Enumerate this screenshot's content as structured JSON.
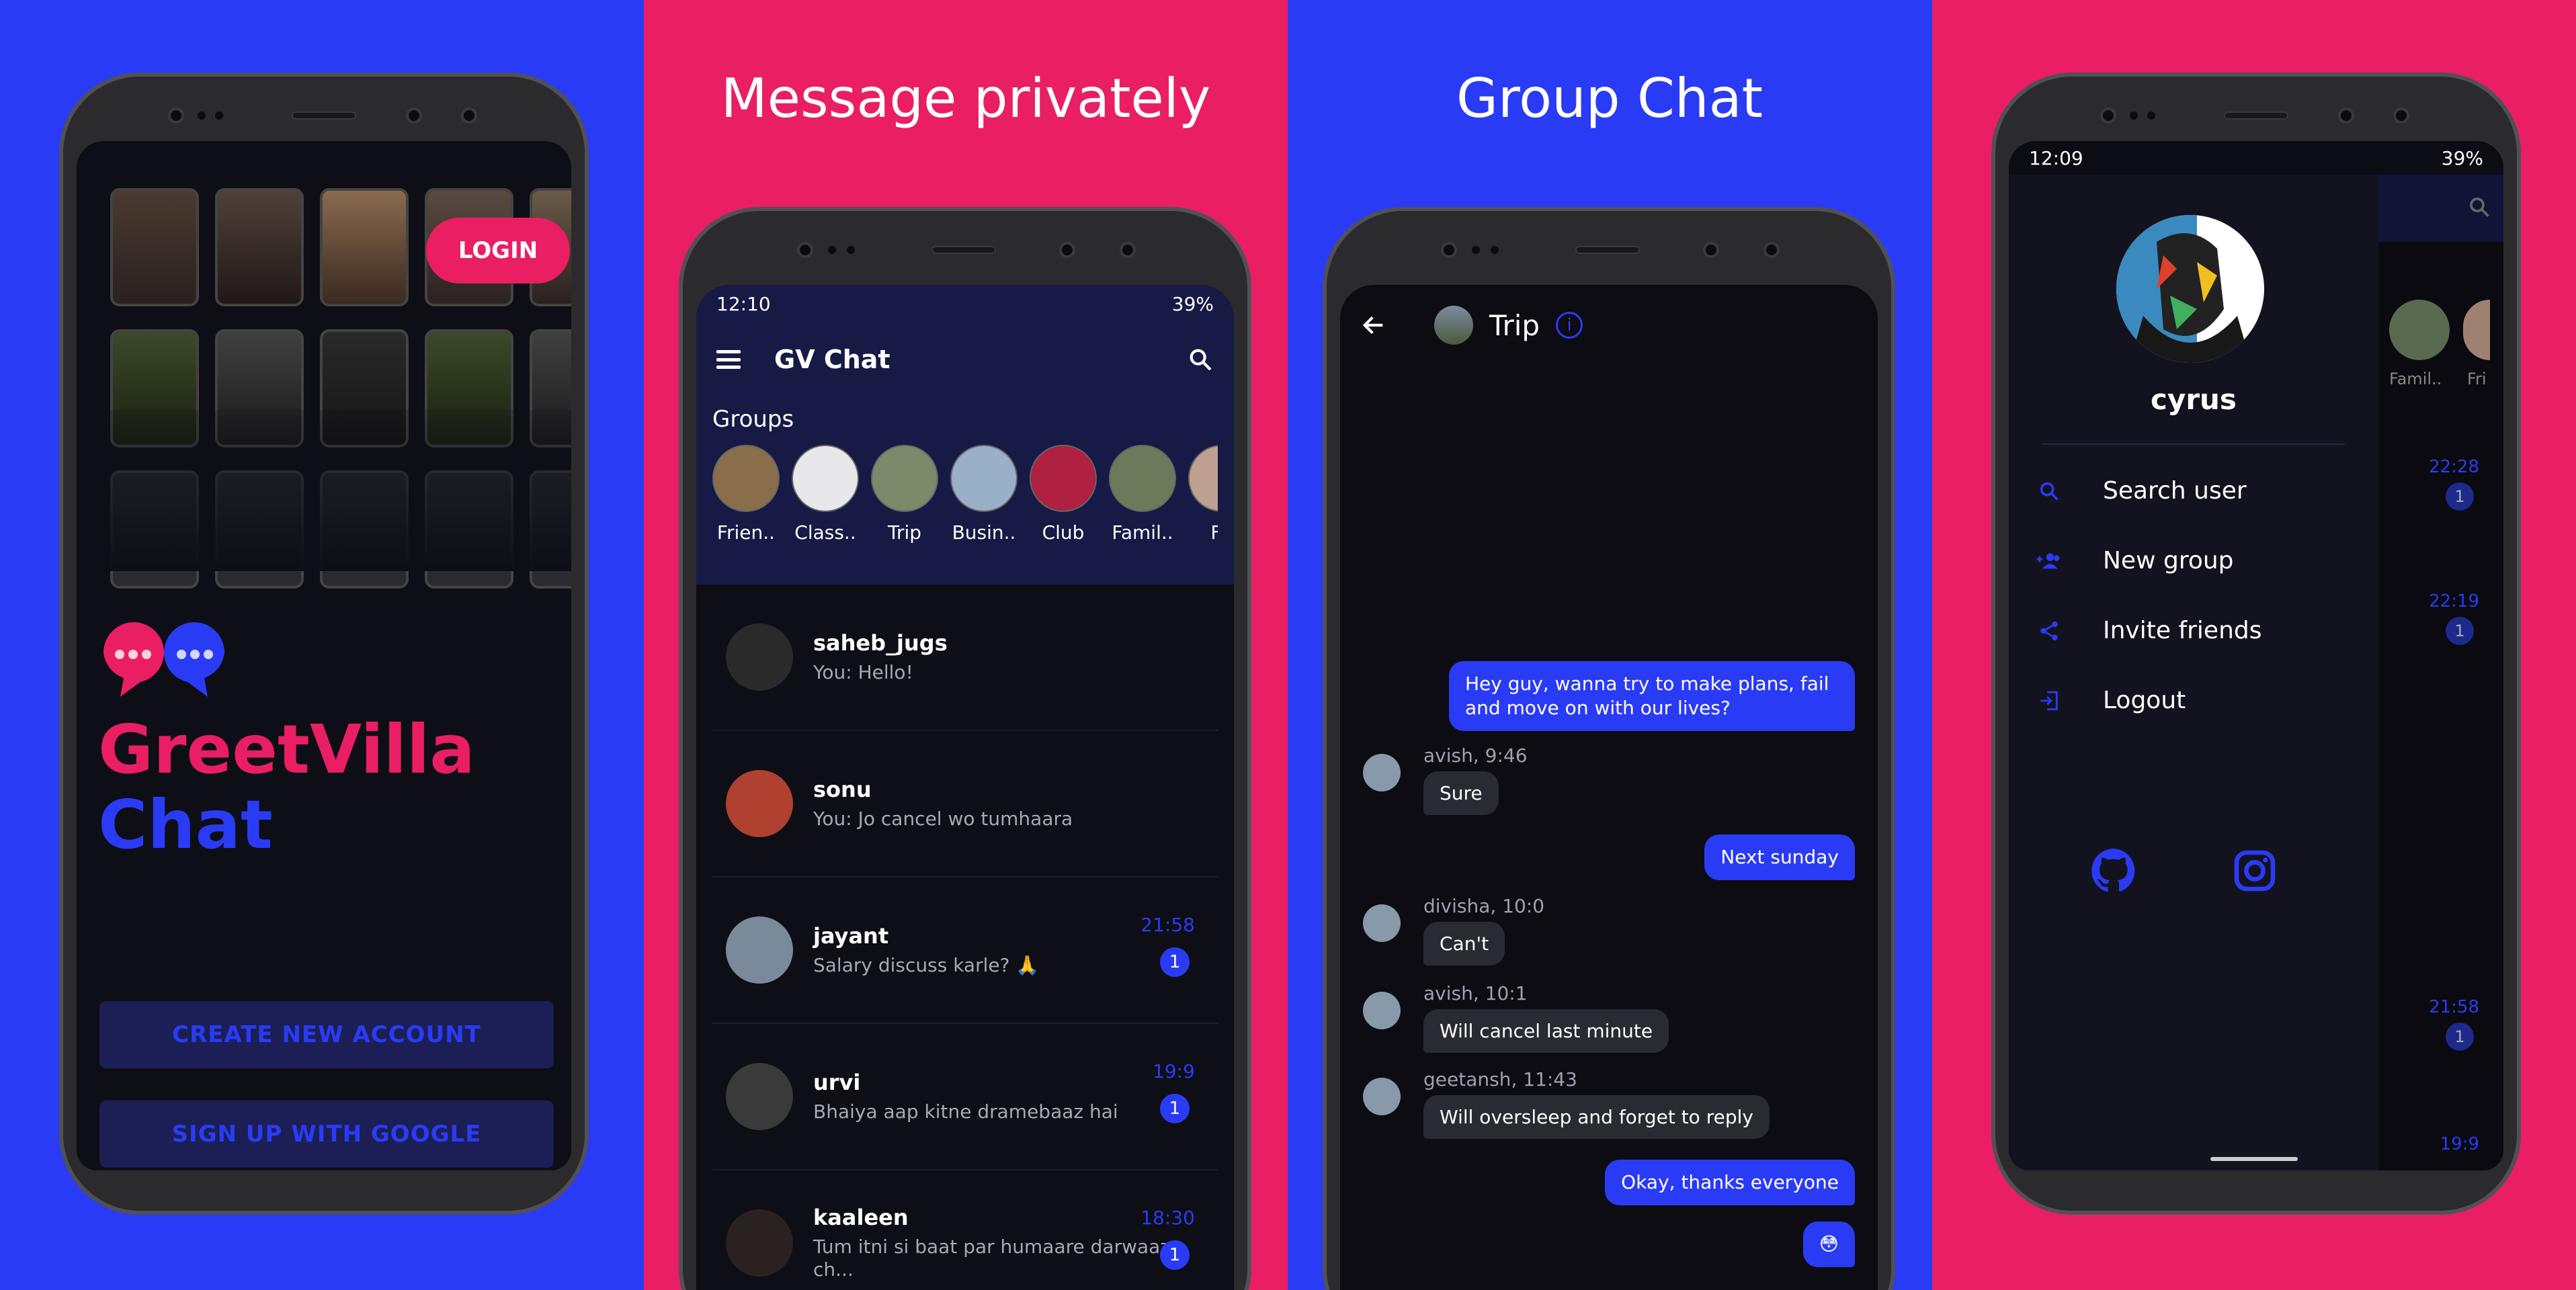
{
  "colors": {
    "blue": "#2a3bf5",
    "pink": "#ea1e63",
    "dark": "#0e0e16",
    "appbar": "#161a45"
  },
  "panel1": {
    "login_label": "LOGIN",
    "brand_line1": "GreetVilla",
    "brand_line2": "Chat",
    "create_account_label": "CREATE NEW ACCOUNT",
    "google_label": "SIGN UP WITH GOOGLE"
  },
  "panel2": {
    "caption": "Message privately",
    "status_time": "12:10",
    "status_battery": "39%",
    "app_title": "GV Chat",
    "groups_heading": "Groups",
    "groups": [
      {
        "name": "Frien..",
        "color": "#8a6d4a"
      },
      {
        "name": "Class..",
        "color": "#e8e8ea"
      },
      {
        "name": "Trip",
        "color": "#7a8a6a"
      },
      {
        "name": "Busin..",
        "color": "#9ab0c8"
      },
      {
        "name": "Club",
        "color": "#b02040"
      },
      {
        "name": "Famil..",
        "color": "#6a7a5a"
      },
      {
        "name": "Fri",
        "color": "#c0a090"
      }
    ],
    "chats": [
      {
        "name": "saheb_jugs",
        "msg": "You: Hello!",
        "time": "",
        "badge": ""
      },
      {
        "name": "sonu",
        "msg": "You: Jo cancel wo tumhaara",
        "time": "",
        "badge": ""
      },
      {
        "name": "jayant",
        "msg": "Salary discuss karle? 🙏",
        "time": "21:58",
        "badge": "1"
      },
      {
        "name": "urvi",
        "msg": "Bhaiya aap kitne dramebaaz hai",
        "time": "19:9",
        "badge": "1"
      },
      {
        "name": "kaaleen",
        "msg": "Tum itni si baat par humaare darwaaze ch...",
        "time": "18:30",
        "badge": "1"
      }
    ]
  },
  "panel3": {
    "caption": "Group Chat",
    "chat_title": "Trip",
    "messages": [
      {
        "dir": "out",
        "text": "Hey guy, wanna try to make plans, fail and move on with our lives?"
      },
      {
        "dir": "in",
        "meta": "avish, 9:46",
        "text": "Sure"
      },
      {
        "dir": "out",
        "text": "Next sunday"
      },
      {
        "dir": "in",
        "meta": "divisha, 10:0",
        "text": "Can't"
      },
      {
        "dir": "in",
        "meta": "avish, 10:1",
        "text": "Will cancel last minute"
      },
      {
        "dir": "in",
        "meta": "geetansh, 11:43",
        "text": "Will oversleep and forget to reply"
      },
      {
        "dir": "out",
        "text": "Okay, thanks everyone"
      },
      {
        "dir": "out",
        "text": "😳"
      }
    ]
  },
  "panel4": {
    "status_time": "12:09",
    "status_battery": "39%",
    "username": "cyrus",
    "menu": [
      {
        "label": "Search user",
        "icon": "search-icon"
      },
      {
        "label": "New group",
        "icon": "group-add-icon"
      },
      {
        "label": "Invite friends",
        "icon": "share-icon"
      },
      {
        "label": "Logout",
        "icon": "logout-icon"
      }
    ],
    "bg_groups": [
      "Famil..",
      "Fri"
    ],
    "bg_times": [
      "22:28",
      "22:19",
      "21:58",
      "19:9"
    ],
    "bg_badge": "1"
  }
}
